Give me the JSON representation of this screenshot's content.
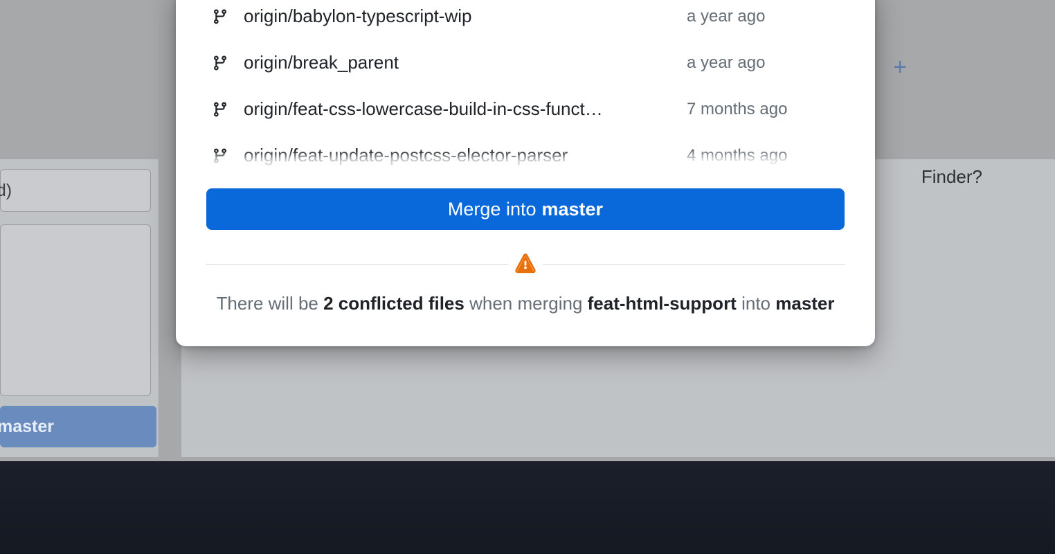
{
  "background": {
    "input_suffix": "ed)",
    "master_button_label": "master",
    "finder_text": "Finder?",
    "plus_icon": "+"
  },
  "modal": {
    "branches": [
      {
        "name": "origin/babylon-typescript-wip",
        "time": "a year ago"
      },
      {
        "name": "origin/break_parent",
        "time": "a year ago"
      },
      {
        "name": "origin/feat-css-lowercase-build-in-css-funct…",
        "time": "7 months ago"
      },
      {
        "name": "origin/feat-update-postcss-elector-parser",
        "time": "4 months ago"
      }
    ],
    "merge_button": {
      "prefix": "Merge into",
      "target": "master"
    },
    "conflict": {
      "pre": "There will be",
      "count_phrase": "2 conflicted files",
      "mid": "when merging",
      "source_branch": "feat-html-support",
      "post": "into",
      "target_branch": "master"
    }
  }
}
